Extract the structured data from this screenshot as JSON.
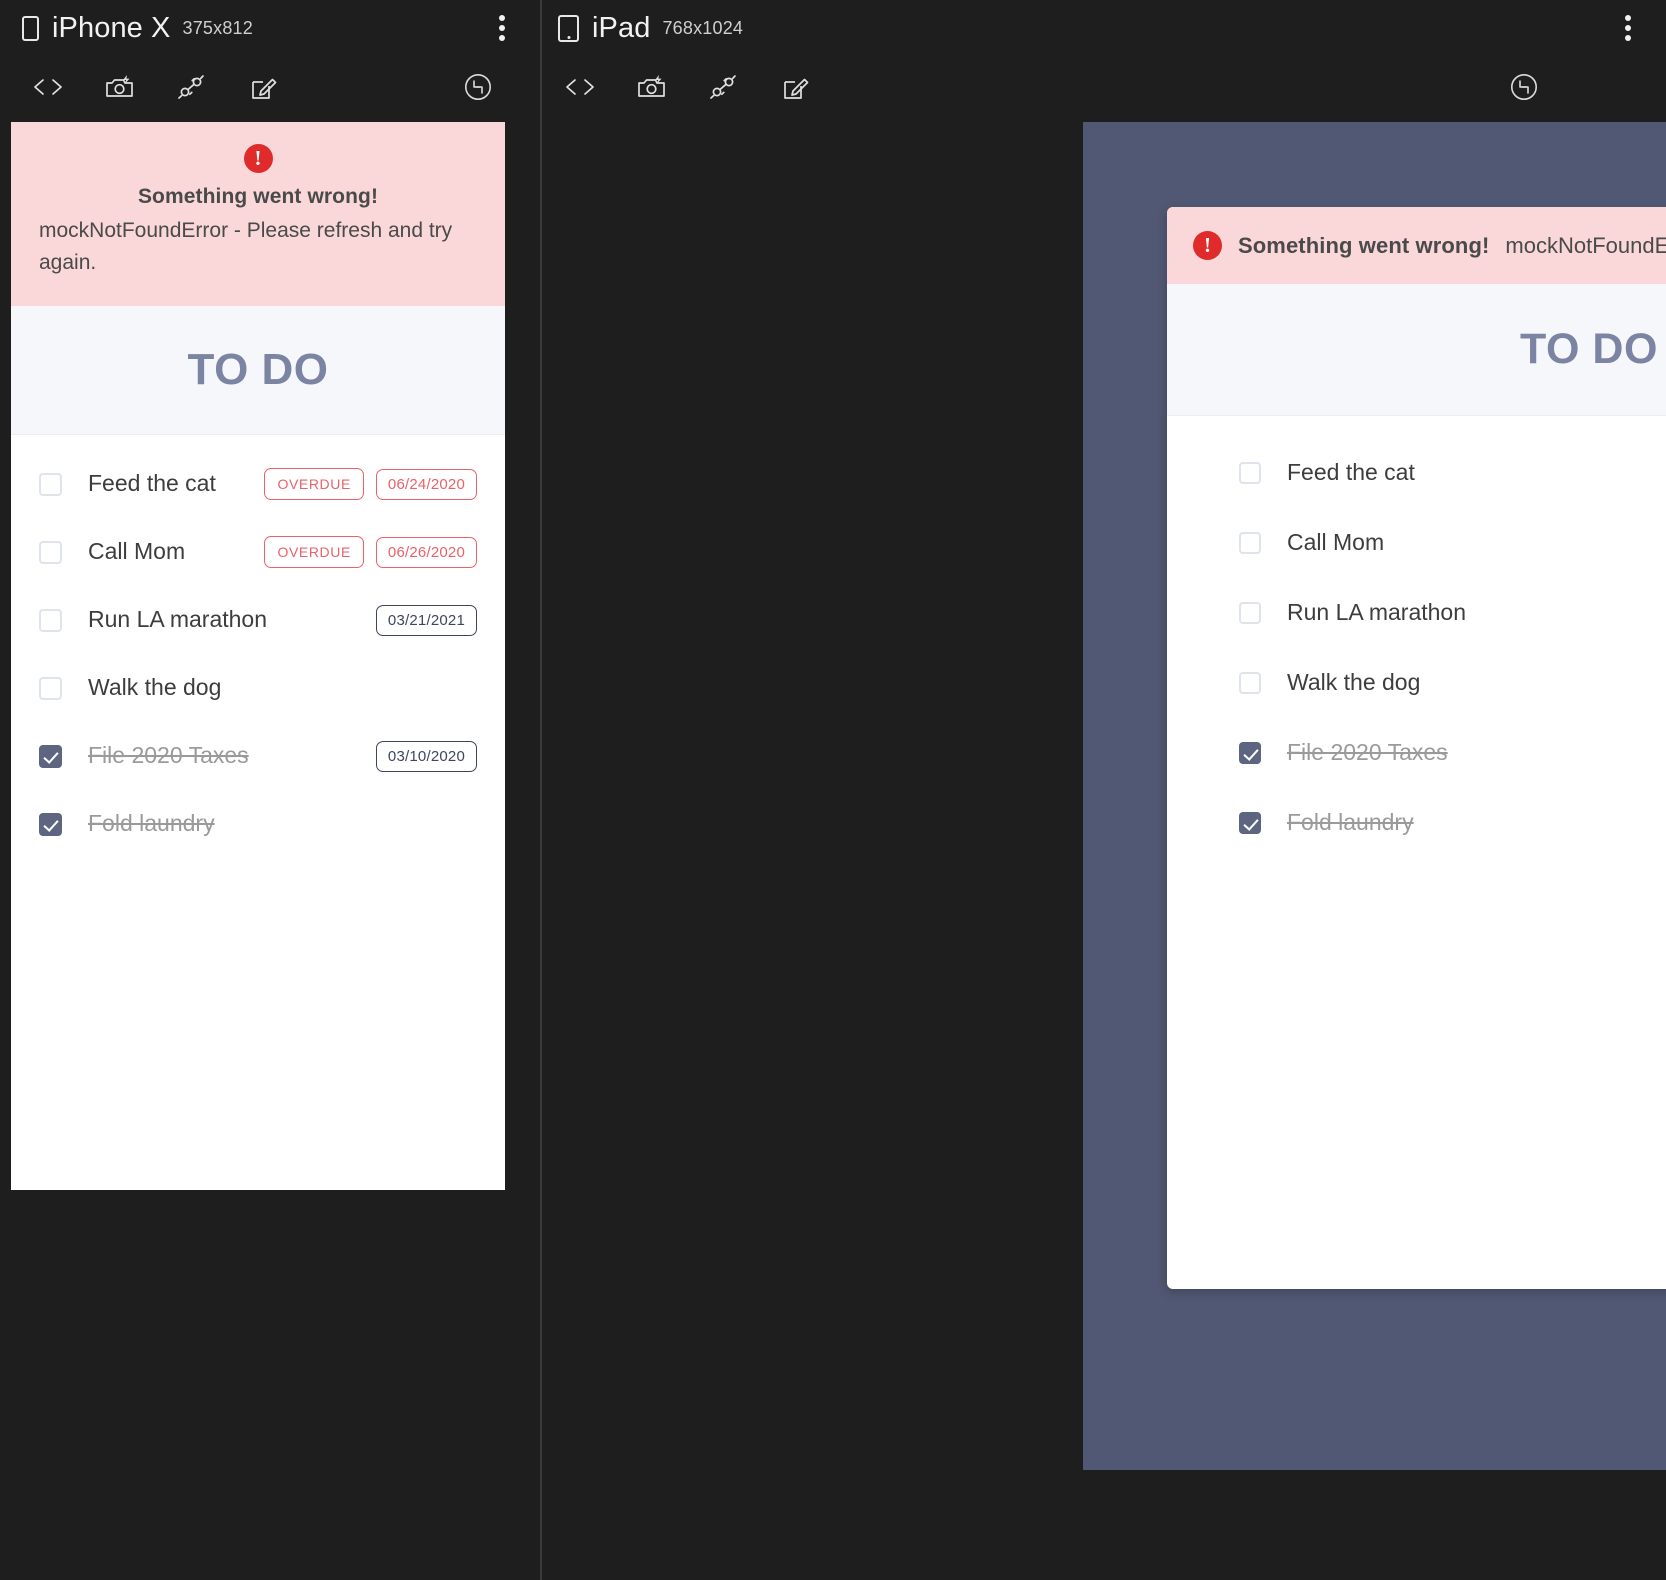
{
  "devices": [
    {
      "name": "iPhone X",
      "dimensions": "375x812",
      "device_icon": "phone-icon",
      "kebab_icon": "more-vertical-icon",
      "toolbar": [
        {
          "icon": "code-brackets-icon",
          "label": "Show code"
        },
        {
          "icon": "camera-flash-icon",
          "label": "Take screenshot"
        },
        {
          "icon": "plug-connector-icon",
          "label": "Connect"
        },
        {
          "icon": "edit-square-icon",
          "label": "Edit"
        }
      ],
      "toolbar_right": {
        "icon": "rotate-expand-icon",
        "label": "Rotate viewport"
      }
    },
    {
      "name": "iPad",
      "dimensions": "768x1024",
      "device_icon": "tablet-icon",
      "kebab_icon": "more-vertical-icon",
      "toolbar": [
        {
          "icon": "code-brackets-icon",
          "label": "Show code"
        },
        {
          "icon": "camera-flash-icon",
          "label": "Take screenshot"
        },
        {
          "icon": "plug-connector-icon",
          "label": "Connect"
        },
        {
          "icon": "edit-square-icon",
          "label": "Edit"
        }
      ],
      "toolbar_right": {
        "icon": "rotate-expand-icon",
        "label": "Rotate viewport"
      }
    }
  ],
  "app": {
    "title": "TO DO",
    "alert": {
      "icon": "error-exclamation-icon",
      "title": "Something went wrong!",
      "message": "mockNotFoundError - Please refresh and try again.",
      "message_phone": "mockNotFoundError - Please refresh and try again."
    },
    "todos": [
      {
        "label": "Feed the cat",
        "done": false,
        "overdue": true,
        "overdue_label": "OVERDUE",
        "date": "06/24/2020"
      },
      {
        "label": "Call Mom",
        "done": false,
        "overdue": true,
        "overdue_label": "OVERDUE",
        "date": "06/26/2020"
      },
      {
        "label": "Run LA marathon",
        "done": false,
        "overdue": false,
        "overdue_label": "",
        "date": "03/21/2021"
      },
      {
        "label": "Walk the dog",
        "done": false,
        "overdue": false,
        "overdue_label": "",
        "date": ""
      },
      {
        "label": "File 2020 Taxes",
        "done": true,
        "overdue": false,
        "overdue_label": "",
        "date": "03/10/2020"
      },
      {
        "label": "Fold laundry",
        "done": true,
        "overdue": false,
        "overdue_label": "",
        "date": ""
      }
    ]
  },
  "colors": {
    "chrome_background": "#1e1e1e",
    "alert_background": "#fad7d9",
    "alert_icon": "#e02b2b",
    "title_band": "#f5f7fb",
    "title_text": "#7c84a3",
    "tablet_viewport": "#515873",
    "checkbox_checked": "#5d6580",
    "overdue": "#e8626b",
    "badge_border": "#3f4560"
  }
}
